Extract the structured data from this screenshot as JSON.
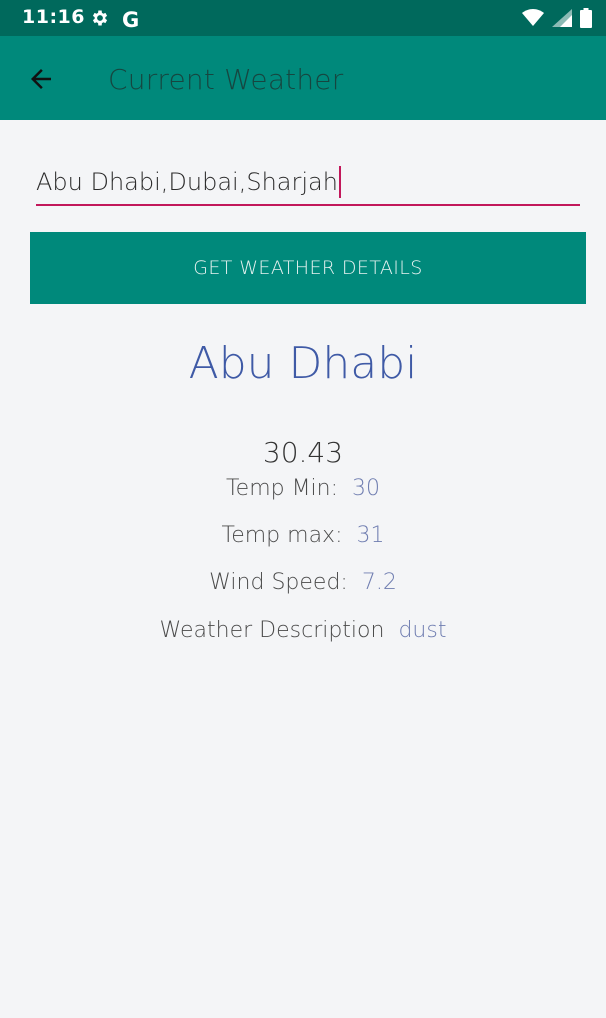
{
  "status_bar": {
    "time": "11:16",
    "icons": [
      "gear-icon",
      "google-g-icon",
      "wifi-icon",
      "signal-icon",
      "battery-icon"
    ],
    "g_letter": "G"
  },
  "app_bar": {
    "title": "Current Weather",
    "back_icon": "arrow-left-icon",
    "color": "#00897b"
  },
  "search": {
    "value": "Abu Dhabi,Dubai,Sharjah",
    "underline_color": "#c2185b"
  },
  "button": {
    "label": "GET WEATHER DETAILS"
  },
  "result": {
    "city": "Abu Dhabi",
    "temperature": "30.43",
    "temp_min_label": "Temp Min:",
    "temp_min_value": "30",
    "temp_max_label": "Temp max:",
    "temp_max_value": "31",
    "wind_label": "Wind Speed:",
    "wind_value": "7.2",
    "desc_label": "Weather Description",
    "desc_value": "dust"
  }
}
